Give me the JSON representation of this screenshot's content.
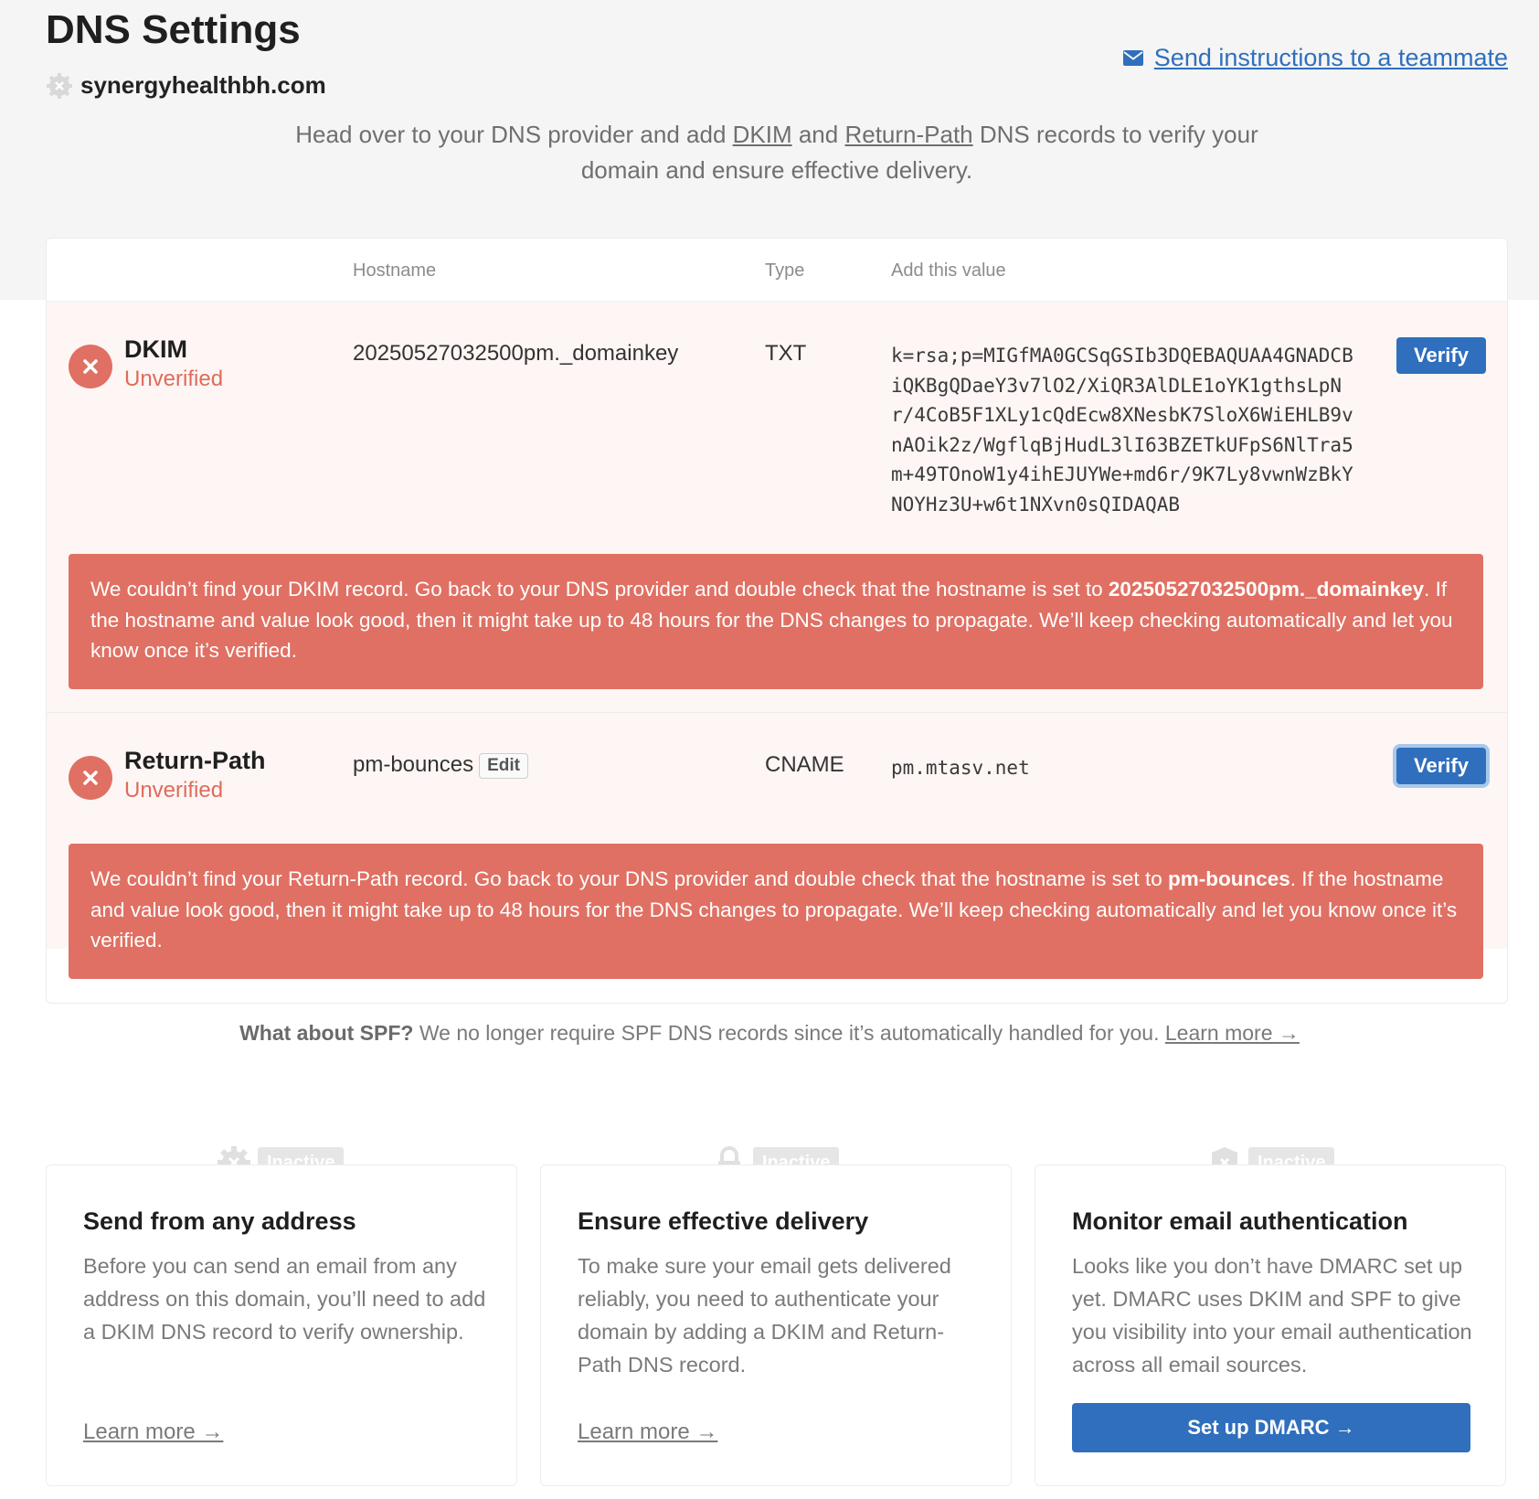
{
  "page": {
    "title": "DNS Settings",
    "domain": "synergyhealthbh.com",
    "send_instructions": "Send instructions to a teammate",
    "intro": {
      "part1": "Head over to your DNS provider and add ",
      "dkim_link": "DKIM",
      "and": " and ",
      "return_path_link": "Return-Path",
      "part2": " DNS records to verify your domain and ensure effective delivery."
    }
  },
  "table": {
    "headers": {
      "hostname": "Hostname",
      "type": "Type",
      "value": "Add this value"
    },
    "records": [
      {
        "name": "DKIM",
        "status": "Unverified",
        "hostname": "20250527032500pm._domainkey",
        "type": "TXT",
        "value": "k=rsa;p=MIGfMA0GCSqGSIb3DQEBAQUAA4GNADCBiQKBgQDaeY3v7lO2/XiQR3AlDLE1oYK1gthsLpNr/4CoB5F1XLy1cQdEcw8XNesbK7SloX6WiEHLB9vnAOik2z/WgflqBjHudL3lI63BZETkUFpS6NlTra5m+49TOnoW1y4ihEJUYWe+md6r/9K7Ly8vwnWzBkYNOYHz3U+w6t1NXvn0sQIDAQAB",
        "verify_label": "Verify",
        "alert": {
          "p1": "We couldn’t find your DKIM record. Go back to your DNS provider and double check that the hostname is set to ",
          "bold": "20250527032500pm._domainkey",
          "p2": ". If the hostname and value look good, then it might take up to 48 hours for the DNS changes to propagate. We’ll keep checking automatically and let you know once it’s verified."
        }
      },
      {
        "name": "Return-Path",
        "status": "Unverified",
        "hostname": "pm-bounces",
        "edit_label": "Edit",
        "type": "CNAME",
        "value": "pm.mtasv.net",
        "verify_label": "Verify",
        "alert": {
          "p1": "We couldn’t find your Return-Path record. Go back to your DNS provider and double check that the hostname is set to ",
          "bold": "pm-bounces",
          "p2": ". If the hostname and value look good, then it might take up to 48 hours for the DNS changes to propagate. We’ll keep checking automatically and let you know once it’s verified."
        }
      }
    ]
  },
  "spf": {
    "bold": "What about SPF?",
    "text": " We no longer require SPF DNS records since it’s automatically handled for you. ",
    "link": "Learn more →"
  },
  "features": [
    {
      "icon": "gear-icon",
      "badge": "Inactive",
      "title": "Send from any address",
      "desc": "Before you can send an email from any address on this domain, you’ll need to add a DKIM DNS record to verify ownership.",
      "link": "Learn more →"
    },
    {
      "icon": "lock-icon",
      "badge": "Inactive",
      "title": "Ensure effective delivery",
      "desc": "To make sure your email gets delivered reliably, you need to authenticate your domain by adding a DKIM and Return-Path DNS record.",
      "link": "Learn more →"
    },
    {
      "icon": "shield-icon",
      "badge": "Inactive",
      "title": "Monitor email authentication",
      "desc": "Looks like you don’t have DMARC set up yet. DMARC uses DKIM and SPF to give you visibility into your email authentication across all email sources.",
      "button": "Set up DMARC →"
    }
  ],
  "colors": {
    "accent": "#2f6fbd",
    "error": "#e07063",
    "error_text": "#e06b5b"
  }
}
